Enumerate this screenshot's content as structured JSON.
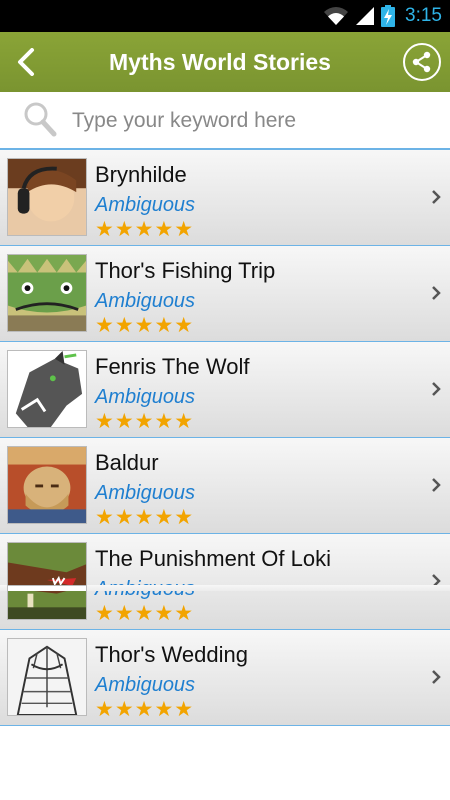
{
  "status": {
    "time": "3:15"
  },
  "appbar": {
    "title": "Myths World Stories"
  },
  "search": {
    "placeholder": "Type your keyword here"
  },
  "stories": [
    {
      "title": "Brynhilde",
      "category": "Ambiguous",
      "rating": "★★★★★"
    },
    {
      "title": "Thor's Fishing Trip",
      "category": "Ambiguous",
      "rating": "★★★★★"
    },
    {
      "title": "Fenris The Wolf",
      "category": "Ambiguous",
      "rating": "★★★★★"
    },
    {
      "title": "Baldur",
      "category": "Ambiguous",
      "rating": "★★★★★"
    },
    {
      "title": "The Punishment Of Loki",
      "category": "Ambiguous",
      "rating": "★★★★★"
    },
    {
      "title": "Thor's Wedding",
      "category": "Ambiguous",
      "rating": "★★★★★"
    }
  ],
  "colors": {
    "appbar": "#7f9a33",
    "accent_blue": "#1f7fd0",
    "star": "#f2a400",
    "divider": "#6cb3e6"
  }
}
